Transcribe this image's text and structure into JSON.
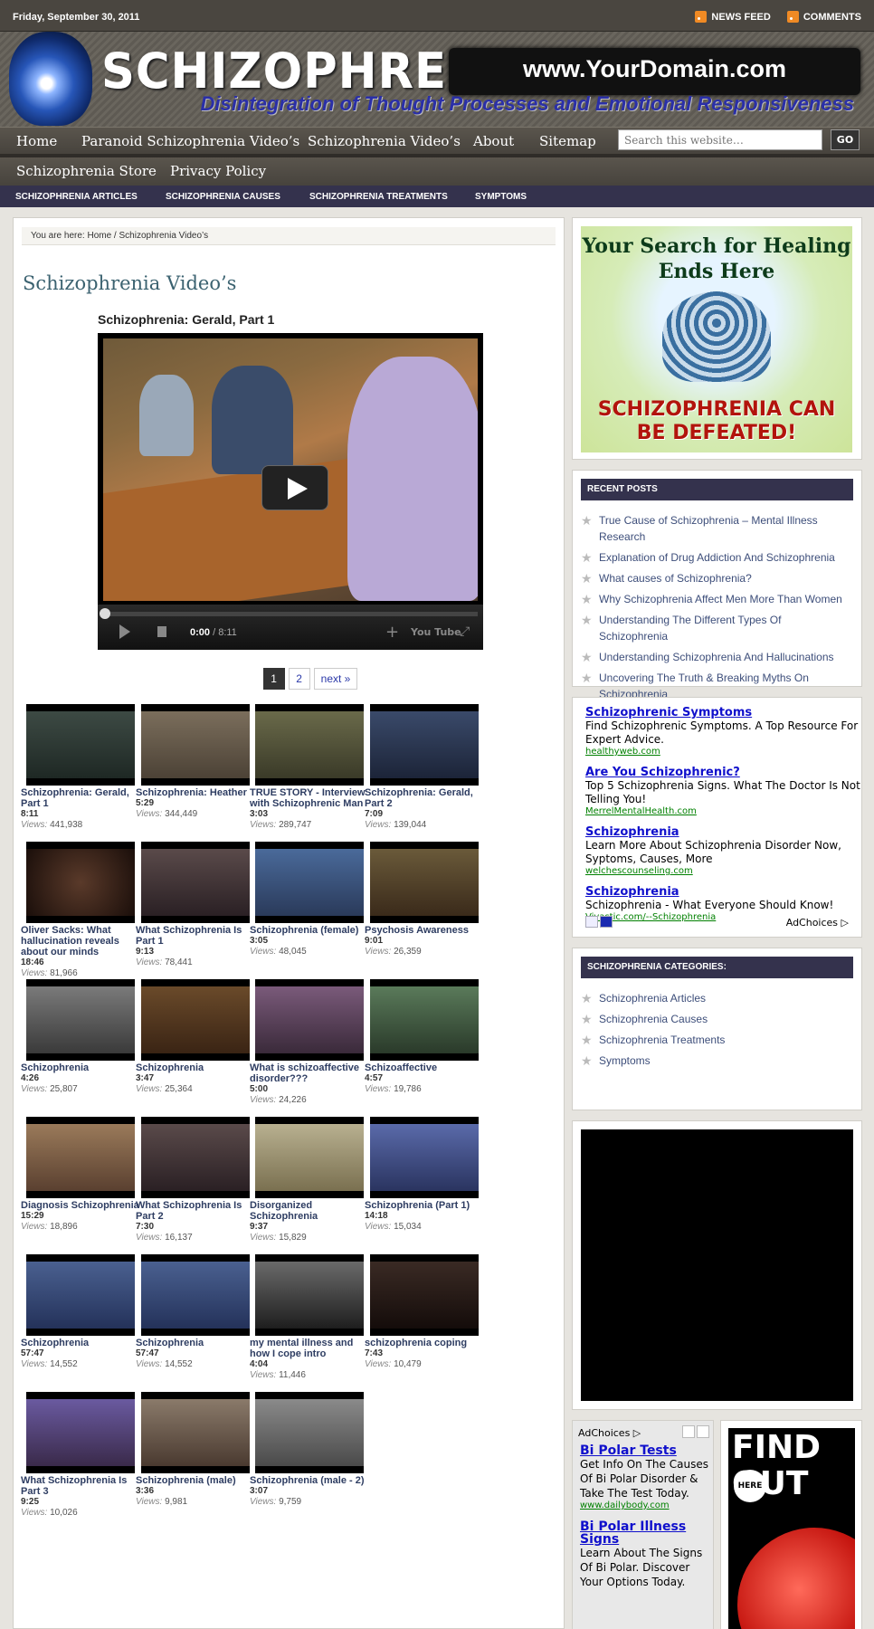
{
  "header": {
    "date": "Friday, September 30, 2011",
    "links": [
      "NEWS FEED",
      "COMMENTS"
    ],
    "site_title": "SCHIZOPHRENIA",
    "domain": "www.YourDomain.com",
    "tagline": "Disintegration of Thought Processes and Emotional Responsiveness"
  },
  "nav_primary": [
    "Home",
    "Paranoid Schizophrenia Video’s",
    "Schizophrenia Video’s",
    "About",
    "Sitemap"
  ],
  "nav_primary_row2": [
    "Schizophrenia Store",
    "Privacy Policy"
  ],
  "search": {
    "placeholder": "Search this website…",
    "button": "GO"
  },
  "nav_categories": [
    "SCHIZOPHRENIA ARTICLES",
    "SCHIZOPHRENIA CAUSES",
    "SCHIZOPHRENIA TREATMENTS",
    "SYMPTOMS"
  ],
  "breadcrumb": {
    "prefix": "You are here:",
    "home": "Home",
    "sep": " / ",
    "current": "Schizophrenia Video’s"
  },
  "page_title": "Schizophrenia Video’s",
  "player": {
    "title": "Schizophrenia: Gerald, Part 1",
    "time_current": "0:00",
    "time_total": " / 8:11",
    "logo": "You Tube"
  },
  "pagination": [
    "1",
    "2",
    "next »"
  ],
  "videos_label": "Views:",
  "videos": [
    {
      "title": "Schizophrenia: Gerald, Part 1",
      "duration": "8:11",
      "views": "441,938"
    },
    {
      "title": "Schizophrenia: Heather",
      "duration": "5:29",
      "views": "344,449"
    },
    {
      "title": "TRUE STORY - Interview with Schizophrenic Man",
      "duration": "3:03",
      "views": "289,747"
    },
    {
      "title": "Schizophrenia: Gerald, Part 2",
      "duration": "7:09",
      "views": "139,044"
    },
    {
      "title": "Oliver Sacks: What hallucination reveals about our minds",
      "duration": "18:46",
      "views": "81,966"
    },
    {
      "title": "What Schizophrenia Is Part 1",
      "duration": "9:13",
      "views": "78,441"
    },
    {
      "title": "Schizophrenia (female)",
      "duration": "3:05",
      "views": "48,045"
    },
    {
      "title": "Psychosis Awareness",
      "duration": "9:01",
      "views": "26,359"
    },
    {
      "title": "Schizophrenia",
      "duration": "4:26",
      "views": "25,807"
    },
    {
      "title": "Schizophrenia",
      "duration": "3:47",
      "views": "25,364"
    },
    {
      "title": "What is schizoaffective disorder???",
      "duration": "5:00",
      "views": "24,226"
    },
    {
      "title": "Schizoaffective",
      "duration": "4:57",
      "views": "19,786"
    },
    {
      "title": "Diagnosis Schizophrenia",
      "duration": "15:29",
      "views": "18,896"
    },
    {
      "title": "What Schizophrenia Is Part 2",
      "duration": "7:30",
      "views": "16,137"
    },
    {
      "title": "Disorganized Schizophrenia",
      "duration": "9:37",
      "views": "15,829"
    },
    {
      "title": "Schizophrenia (Part 1)",
      "duration": "14:18",
      "views": "15,034"
    },
    {
      "title": "Schizophrenia",
      "duration": "57:47",
      "views": "14,552"
    },
    {
      "title": "Schizophrenia",
      "duration": "57:47",
      "views": "14,552"
    },
    {
      "title": "my mental illness and how I cope intro",
      "duration": "4:04",
      "views": "11,446"
    },
    {
      "title": "schizophrenia coping",
      "duration": "7:43",
      "views": "10,479"
    },
    {
      "title": "What Schizophrenia Is Part 3",
      "duration": "9:25",
      "views": "10,026"
    },
    {
      "title": "Schizophrenia (male)",
      "duration": "3:36",
      "views": "9,981"
    },
    {
      "title": "Schizophrenia (male - 2)",
      "duration": "3:07",
      "views": "9,759"
    }
  ],
  "sidebar": {
    "ad_banner": {
      "line1": "Your Search for Healing Ends Here",
      "line2": "SCHIZOPHRENIA CAN BE DEFEATED!"
    },
    "recent_posts_title": "RECENT POSTS",
    "recent_posts": [
      "True Cause of Schizophrenia – Mental Illness Research",
      "Explanation of Drug Addiction And Schizophrenia",
      "What causes of Schizophrenia?",
      "Why Schizophrenia Affect Men More Than Women",
      "Understanding The Different Types Of Schizophrenia",
      "Understanding Schizophrenia And Hallucinations",
      "Uncovering The Truth & Breaking Myths On Schizophrenia"
    ],
    "google_ads": [
      {
        "head": "Schizophrenic Symptoms",
        "desc": "Find Schizophrenic Symptoms. A Top Resource For Expert Advice.",
        "url": "healthyweb.com"
      },
      {
        "head": "Are You Schizophrenic?",
        "desc": "Top 5 Schizophrenia Signs. What The Doctor Is Not Telling You!",
        "url": "MerrelMentalHealth.com"
      },
      {
        "head": "Schizophrenia",
        "desc": "Learn More About Schizophrenia Disorder Now, Syptoms, Causes, More",
        "url": "welchescounseling.com"
      },
      {
        "head": "Schizophrenia",
        "desc": "Schizophrenia - What Everyone Should Know!",
        "url": "Vivastic.com/--Schizophrenia"
      }
    ],
    "adchoices": "AdChoices ▷",
    "categories_title": "SCHIZOPHRENIA CATEGORIES:",
    "categories": [
      "Schizophrenia Articles",
      "Schizophrenia Causes",
      "Schizophrenia Treatments",
      "Symptoms"
    ],
    "small_ads": [
      {
        "head": "Bi Polar Tests",
        "desc": "Get Info On The Causes Of Bi Polar Disorder & Take The Test Today.",
        "url": "www.dailybody.com"
      },
      {
        "head": "Bi Polar Illness Signs",
        "desc": "Learn About The Signs Of Bi Polar. Discover Your Options Today.",
        "url": ""
      }
    ],
    "find_out": {
      "text": "FIND OUT",
      "here": "HERE"
    }
  },
  "colors": {
    "nav_dark": "#34324d",
    "link": "#3d4e7a",
    "title": "#3b6270",
    "ad_link": "#1010cc",
    "ad_url": "#008000"
  }
}
